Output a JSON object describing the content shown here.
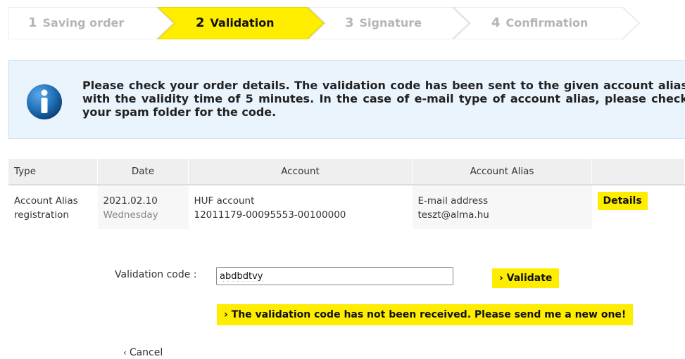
{
  "steps": [
    {
      "number": "1",
      "label": "Saving order"
    },
    {
      "number": "2",
      "label": "Validation"
    },
    {
      "number": "3",
      "label": "Signature"
    },
    {
      "number": "4",
      "label": "Confirmation"
    }
  ],
  "colors": {
    "accent": "#ffed00",
    "info_bg": "#eaf4fc",
    "info_icon": "#1f6fb5"
  },
  "info": {
    "icon": "info-icon",
    "message": "Please check your order details. The validation code has been sent to the given account alias with the validity time of 5 minutes. In the case of e-mail type of account alias, please check your spam folder for the code."
  },
  "table": {
    "headers": [
      "Type",
      "Date",
      "Account",
      "Account Alias",
      ""
    ],
    "row": {
      "type_line1": "Account Alias",
      "type_line2": "registration",
      "date": "2021.02.10",
      "weekday": "Wednesday",
      "account_name": "HUF account",
      "account_number": "12011179-00095553-00100000",
      "alias_type": "E-mail address",
      "alias_value": "teszt@alma.hu",
      "details_label": "Details"
    }
  },
  "validation": {
    "label": "Validation code :",
    "value": "abdbdtvy",
    "validate_label": "Validate",
    "resend_label": "The validation code has not been received. Please send me a new one!"
  },
  "cancel_label": "Cancel"
}
